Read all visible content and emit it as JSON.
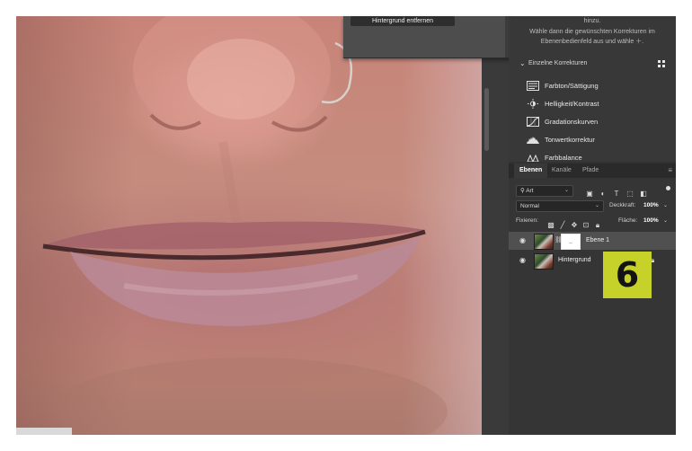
{
  "popup": {
    "button_label": "Hintergrund entfernen"
  },
  "adjustments": {
    "hint_line1": "hinzu.",
    "hint_line2": "Wähle dann die gewünschten Korrekturen im",
    "hint_line3": "Ebenenbedienfeld aus und wähle",
    "hint_plus": "＋.",
    "section_label": "Einzelne Korrekturen",
    "items": [
      {
        "label": "Farbton/Sättigung",
        "icon": "hue-saturation-icon"
      },
      {
        "label": "Helligkeit/Kontrast",
        "icon": "brightness-contrast-icon"
      },
      {
        "label": "Gradationskurven",
        "icon": "curves-icon"
      },
      {
        "label": "Tonwertkorrektur",
        "icon": "levels-icon"
      },
      {
        "label": "Farbbalance",
        "icon": "color-balance-icon"
      }
    ]
  },
  "layers_panel": {
    "tabs": [
      "Ebenen",
      "Kanäle",
      "Pfade"
    ],
    "kind_filter": "Art",
    "blend_mode": "Normal",
    "opacity_label": "Deckkraft:",
    "opacity_value": "100%",
    "lock_label": "Fixieren:",
    "fill_label": "Fläche:",
    "fill_value": "100%",
    "layers": [
      {
        "name": "Ebene 1",
        "selected": true,
        "has_mask": true
      },
      {
        "name": "Hintergrund",
        "selected": false,
        "locked": true
      }
    ]
  },
  "step_badge": "6",
  "colors": {
    "badge": "#c6d22a",
    "panel_bg": "#323232",
    "selected_layer": "#505050"
  }
}
